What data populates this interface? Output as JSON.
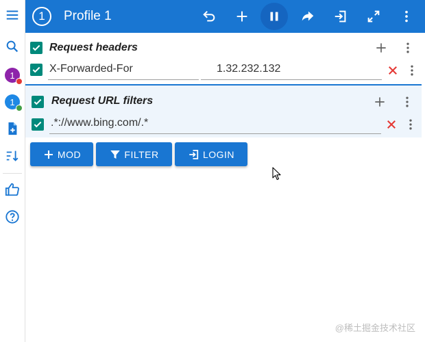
{
  "colors": {
    "primary": "#1976d2",
    "primary_dark": "#1565c0",
    "checkbox": "#00897b",
    "delete": "#e53935",
    "profile1": "#8e24aa",
    "profile2": "#1e88e5",
    "status_red": "#e53935",
    "status_green": "#43a047"
  },
  "sidebar": {
    "items": [
      {
        "name": "menu",
        "icon": "menu-icon"
      },
      {
        "name": "search",
        "icon": "search-icon"
      },
      {
        "name": "profile-1",
        "label": "1",
        "icon": "profile-badge"
      },
      {
        "name": "profile-2",
        "label": "1",
        "icon": "profile-badge"
      },
      {
        "name": "add-file",
        "icon": "note-add-icon"
      },
      {
        "name": "sort",
        "icon": "sort-icon"
      },
      {
        "name": "like",
        "icon": "thumb-up-icon"
      },
      {
        "name": "help",
        "icon": "help-icon"
      }
    ],
    "profile1_label": "1",
    "profile2_label": "1"
  },
  "header": {
    "profile_number": "1",
    "title": "Profile 1",
    "actions": [
      "undo-icon",
      "add-icon",
      "pause-icon",
      "share-icon",
      "login-icon",
      "fullscreen-icon",
      "more-vert-icon"
    ]
  },
  "request_headers": {
    "title": "Request headers",
    "enabled": true,
    "rows": [
      {
        "enabled": true,
        "name": "X-Forwarded-For",
        "value": "1.32.232.132"
      }
    ]
  },
  "url_filters": {
    "title": "Request URL filters",
    "enabled": true,
    "rows": [
      {
        "enabled": true,
        "pattern": ".*://www.bing.com/.*"
      }
    ]
  },
  "buttons": {
    "mod": "MOD",
    "filter": "FILTER",
    "login": "LOGIN"
  },
  "watermark": "@稀土掘金技术社区"
}
